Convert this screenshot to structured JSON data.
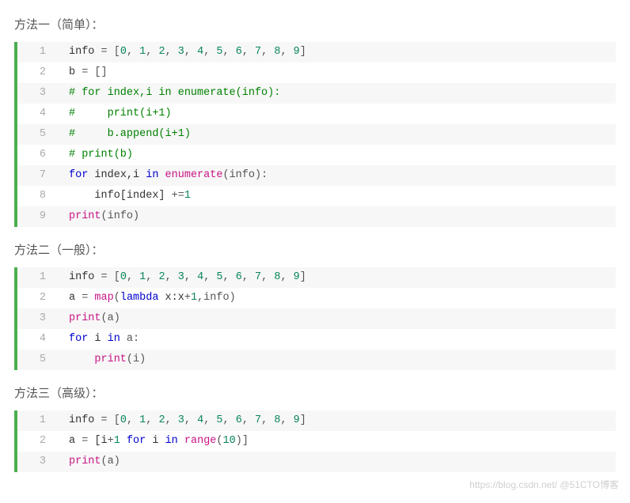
{
  "sections": [
    {
      "heading": "方法一（简单）：",
      "lines": [
        [
          {
            "t": "info ",
            "c": ""
          },
          {
            "t": "=",
            "c": "t-op"
          },
          {
            "t": " [",
            "c": "t-punc"
          },
          {
            "t": "0",
            "c": "t-num"
          },
          {
            "t": ", ",
            "c": "t-punc"
          },
          {
            "t": "1",
            "c": "t-num"
          },
          {
            "t": ", ",
            "c": "t-punc"
          },
          {
            "t": "2",
            "c": "t-num"
          },
          {
            "t": ", ",
            "c": "t-punc"
          },
          {
            "t": "3",
            "c": "t-num"
          },
          {
            "t": ", ",
            "c": "t-punc"
          },
          {
            "t": "4",
            "c": "t-num"
          },
          {
            "t": ", ",
            "c": "t-punc"
          },
          {
            "t": "5",
            "c": "t-num"
          },
          {
            "t": ", ",
            "c": "t-punc"
          },
          {
            "t": "6",
            "c": "t-num"
          },
          {
            "t": ", ",
            "c": "t-punc"
          },
          {
            "t": "7",
            "c": "t-num"
          },
          {
            "t": ", ",
            "c": "t-punc"
          },
          {
            "t": "8",
            "c": "t-num"
          },
          {
            "t": ", ",
            "c": "t-punc"
          },
          {
            "t": "9",
            "c": "t-num"
          },
          {
            "t": "]",
            "c": "t-punc"
          }
        ],
        [
          {
            "t": "b ",
            "c": ""
          },
          {
            "t": "=",
            "c": "t-op"
          },
          {
            "t": " []",
            "c": "t-punc"
          }
        ],
        [
          {
            "t": "# for index,i in enumerate(info):",
            "c": "t-comment"
          }
        ],
        [
          {
            "t": "#     print(i+1)",
            "c": "t-comment"
          }
        ],
        [
          {
            "t": "#     b.append(i+1)",
            "c": "t-comment"
          }
        ],
        [
          {
            "t": "# print(b)",
            "c": "t-comment"
          }
        ],
        [
          {
            "t": "for",
            "c": "t-kw"
          },
          {
            "t": " index,i ",
            "c": ""
          },
          {
            "t": "in",
            "c": "t-kw"
          },
          {
            "t": " ",
            "c": ""
          },
          {
            "t": "enumerate",
            "c": "t-builtin"
          },
          {
            "t": "(info):",
            "c": "t-punc"
          }
        ],
        [
          {
            "t": "    info[index] ",
            "c": ""
          },
          {
            "t": "+=",
            "c": "t-op"
          },
          {
            "t": "1",
            "c": "t-num"
          }
        ],
        [
          {
            "t": "print",
            "c": "t-builtin"
          },
          {
            "t": "(info)",
            "c": "t-punc"
          }
        ]
      ]
    },
    {
      "heading": "方法二（一般）：",
      "lines": [
        [
          {
            "t": "info ",
            "c": ""
          },
          {
            "t": "=",
            "c": "t-op"
          },
          {
            "t": " [",
            "c": "t-punc"
          },
          {
            "t": "0",
            "c": "t-num"
          },
          {
            "t": ", ",
            "c": "t-punc"
          },
          {
            "t": "1",
            "c": "t-num"
          },
          {
            "t": ", ",
            "c": "t-punc"
          },
          {
            "t": "2",
            "c": "t-num"
          },
          {
            "t": ", ",
            "c": "t-punc"
          },
          {
            "t": "3",
            "c": "t-num"
          },
          {
            "t": ", ",
            "c": "t-punc"
          },
          {
            "t": "4",
            "c": "t-num"
          },
          {
            "t": ", ",
            "c": "t-punc"
          },
          {
            "t": "5",
            "c": "t-num"
          },
          {
            "t": ", ",
            "c": "t-punc"
          },
          {
            "t": "6",
            "c": "t-num"
          },
          {
            "t": ", ",
            "c": "t-punc"
          },
          {
            "t": "7",
            "c": "t-num"
          },
          {
            "t": ", ",
            "c": "t-punc"
          },
          {
            "t": "8",
            "c": "t-num"
          },
          {
            "t": ", ",
            "c": "t-punc"
          },
          {
            "t": "9",
            "c": "t-num"
          },
          {
            "t": "]",
            "c": "t-punc"
          }
        ],
        [
          {
            "t": "a ",
            "c": ""
          },
          {
            "t": "=",
            "c": "t-op"
          },
          {
            "t": " ",
            "c": ""
          },
          {
            "t": "map",
            "c": "t-builtin"
          },
          {
            "t": "(",
            "c": "t-punc"
          },
          {
            "t": "lambda",
            "c": "t-kw"
          },
          {
            "t": " x:x",
            "c": ""
          },
          {
            "t": "+",
            "c": "t-op"
          },
          {
            "t": "1",
            "c": "t-num"
          },
          {
            "t": ",info)",
            "c": "t-punc"
          }
        ],
        [
          {
            "t": "print",
            "c": "t-builtin"
          },
          {
            "t": "(a)",
            "c": "t-punc"
          }
        ],
        [
          {
            "t": "for",
            "c": "t-kw"
          },
          {
            "t": " i ",
            "c": ""
          },
          {
            "t": "in",
            "c": "t-kw"
          },
          {
            "t": " a:",
            "c": "t-punc"
          }
        ],
        [
          {
            "t": "    ",
            "c": ""
          },
          {
            "t": "print",
            "c": "t-builtin"
          },
          {
            "t": "(i)",
            "c": "t-punc"
          }
        ]
      ]
    },
    {
      "heading": "方法三（高级）：",
      "lines": [
        [
          {
            "t": "info ",
            "c": ""
          },
          {
            "t": "=",
            "c": "t-op"
          },
          {
            "t": " [",
            "c": "t-punc"
          },
          {
            "t": "0",
            "c": "t-num"
          },
          {
            "t": ", ",
            "c": "t-punc"
          },
          {
            "t": "1",
            "c": "t-num"
          },
          {
            "t": ", ",
            "c": "t-punc"
          },
          {
            "t": "2",
            "c": "t-num"
          },
          {
            "t": ", ",
            "c": "t-punc"
          },
          {
            "t": "3",
            "c": "t-num"
          },
          {
            "t": ", ",
            "c": "t-punc"
          },
          {
            "t": "4",
            "c": "t-num"
          },
          {
            "t": ", ",
            "c": "t-punc"
          },
          {
            "t": "5",
            "c": "t-num"
          },
          {
            "t": ", ",
            "c": "t-punc"
          },
          {
            "t": "6",
            "c": "t-num"
          },
          {
            "t": ", ",
            "c": "t-punc"
          },
          {
            "t": "7",
            "c": "t-num"
          },
          {
            "t": ", ",
            "c": "t-punc"
          },
          {
            "t": "8",
            "c": "t-num"
          },
          {
            "t": ", ",
            "c": "t-punc"
          },
          {
            "t": "9",
            "c": "t-num"
          },
          {
            "t": "]",
            "c": "t-punc"
          }
        ],
        [
          {
            "t": "a ",
            "c": ""
          },
          {
            "t": "=",
            "c": "t-op"
          },
          {
            "t": " [i",
            "c": ""
          },
          {
            "t": "+",
            "c": "t-op"
          },
          {
            "t": "1",
            "c": "t-num"
          },
          {
            "t": " ",
            "c": ""
          },
          {
            "t": "for",
            "c": "t-kw"
          },
          {
            "t": " i ",
            "c": ""
          },
          {
            "t": "in",
            "c": "t-kw"
          },
          {
            "t": " ",
            "c": ""
          },
          {
            "t": "range",
            "c": "t-builtin"
          },
          {
            "t": "(",
            "c": "t-punc"
          },
          {
            "t": "10",
            "c": "t-num"
          },
          {
            "t": ")]",
            "c": "t-punc"
          }
        ],
        [
          {
            "t": "print",
            "c": "t-builtin"
          },
          {
            "t": "(a)",
            "c": "t-punc"
          }
        ]
      ]
    }
  ],
  "watermark": "https://blog.csdn.net/   @51CTO博客"
}
